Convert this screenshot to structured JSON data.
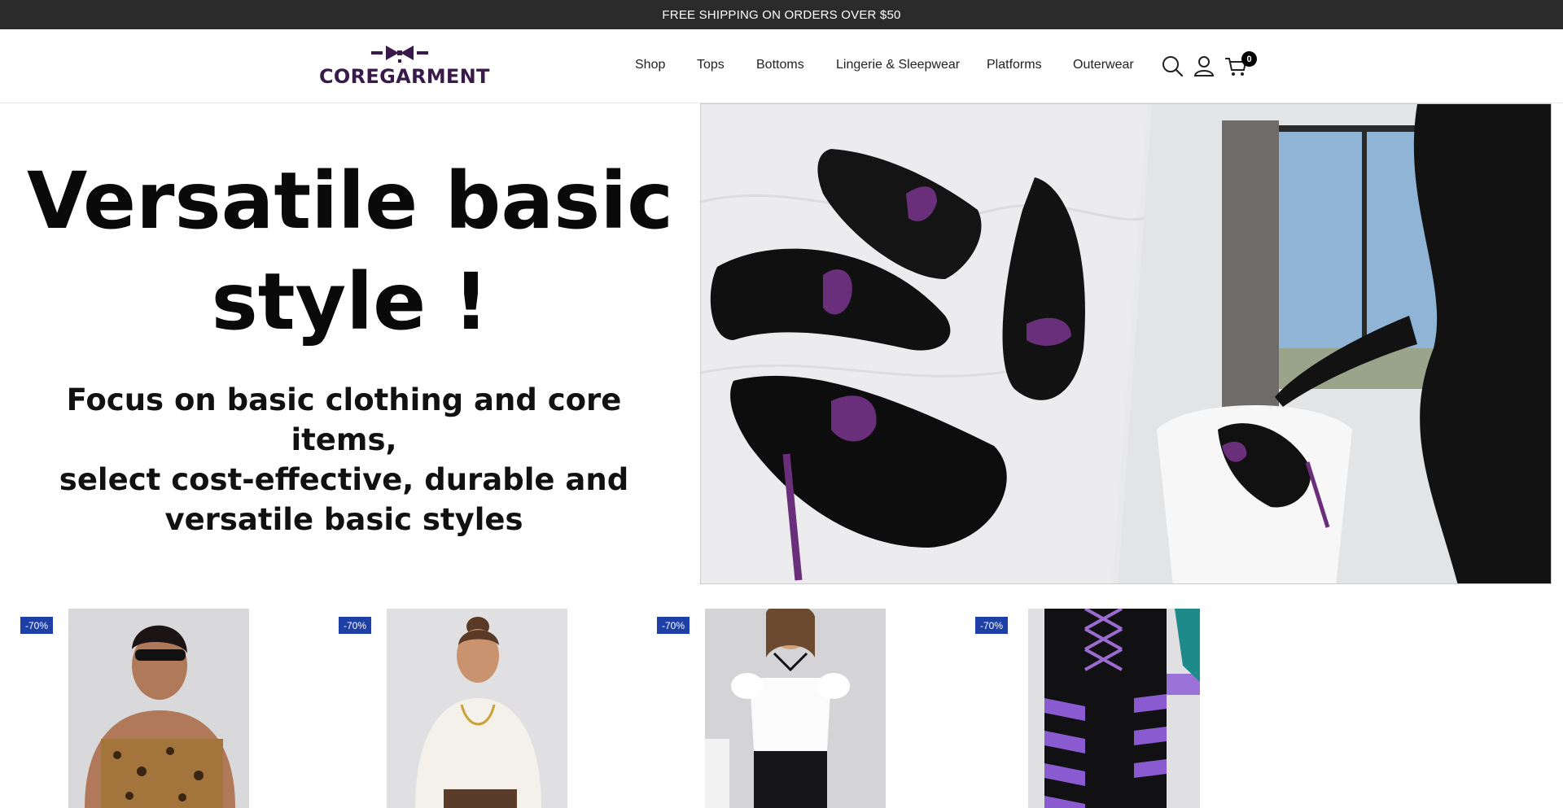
{
  "announcement": "FREE SHIPPING ON ORDERS OVER $50",
  "brand": {
    "logo_text": "COREGARMENT",
    "logo_color": "#3a1a4a"
  },
  "nav": {
    "items": [
      {
        "label": "Shop"
      },
      {
        "label": "Tops"
      },
      {
        "label": "Bottoms"
      },
      {
        "label": "Lingerie & Sleepwear"
      },
      {
        "label": "Platforms"
      },
      {
        "label": "Outerwear"
      }
    ],
    "icons": [
      "search-icon",
      "account-icon",
      "cart-icon"
    ],
    "cart_count": "0"
  },
  "hero": {
    "title_line1": "Versatile basic",
    "title_line2": "style !",
    "subtitle_line1": "Focus on basic clothing and core items,",
    "subtitle_line2": "select cost-effective, durable and",
    "subtitle_line3": "versatile basic styles"
  },
  "products": [
    {
      "discount": "-70%"
    },
    {
      "discount": "-70%"
    },
    {
      "discount": "-70%"
    },
    {
      "discount": "-70%"
    }
  ],
  "colors": {
    "announcement_bg": "#2b2b2b",
    "discount_badge": "#1d3fa6",
    "accent_purple": "#7a3a9a"
  }
}
